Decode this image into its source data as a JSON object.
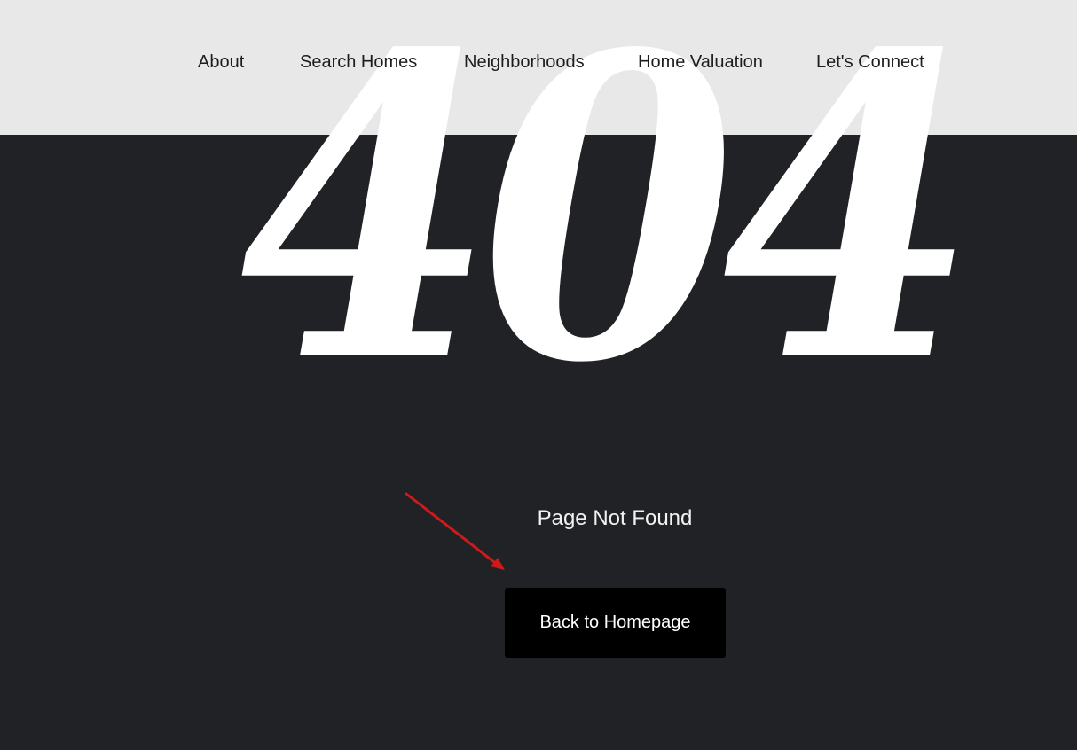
{
  "nav": {
    "items": [
      {
        "label": "About"
      },
      {
        "label": "Search Homes"
      },
      {
        "label": "Neighborhoods"
      },
      {
        "label": "Home Valuation"
      },
      {
        "label": "Let's Connect"
      }
    ]
  },
  "error": {
    "code": "404",
    "message": "Page Not Found",
    "button_label": "Back to Homepage"
  },
  "colors": {
    "header_background": "#e8e8e8",
    "page_background": "#212226",
    "button_background": "#000000",
    "annotation_arrow": "#d0191b"
  },
  "annotation": {
    "icon": "red-arrow-icon"
  }
}
